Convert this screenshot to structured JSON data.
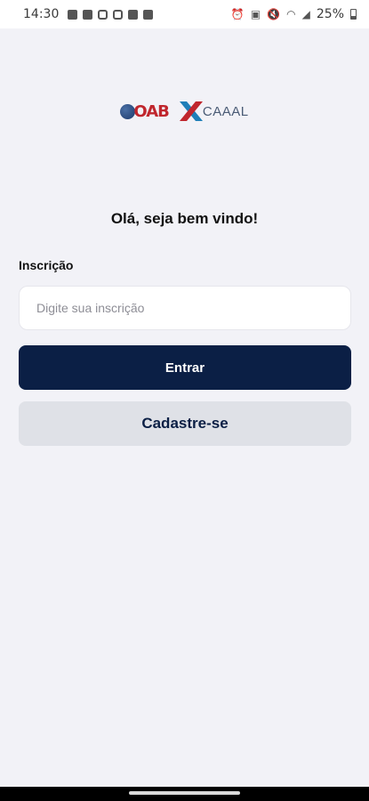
{
  "status_bar": {
    "time": "14:30",
    "notification_icons": [
      "message-icon",
      "mail-icon",
      "instagram-icon",
      "instagram-icon",
      "gallery-icon",
      "x-icon"
    ],
    "battery": "25%"
  },
  "logos": {
    "oab": "OAB",
    "caaal": "CAAAL"
  },
  "greeting": "Olá, seja bem vindo!",
  "form": {
    "label": "Inscrição",
    "placeholder": "Digite sua inscrição",
    "value": ""
  },
  "buttons": {
    "enter": "Entrar",
    "register": "Cadastre-se"
  },
  "colors": {
    "primary": "#0b1f45",
    "secondary": "#dfe1e7",
    "background": "#f2f2f7",
    "oab_red": "#c0262d"
  }
}
